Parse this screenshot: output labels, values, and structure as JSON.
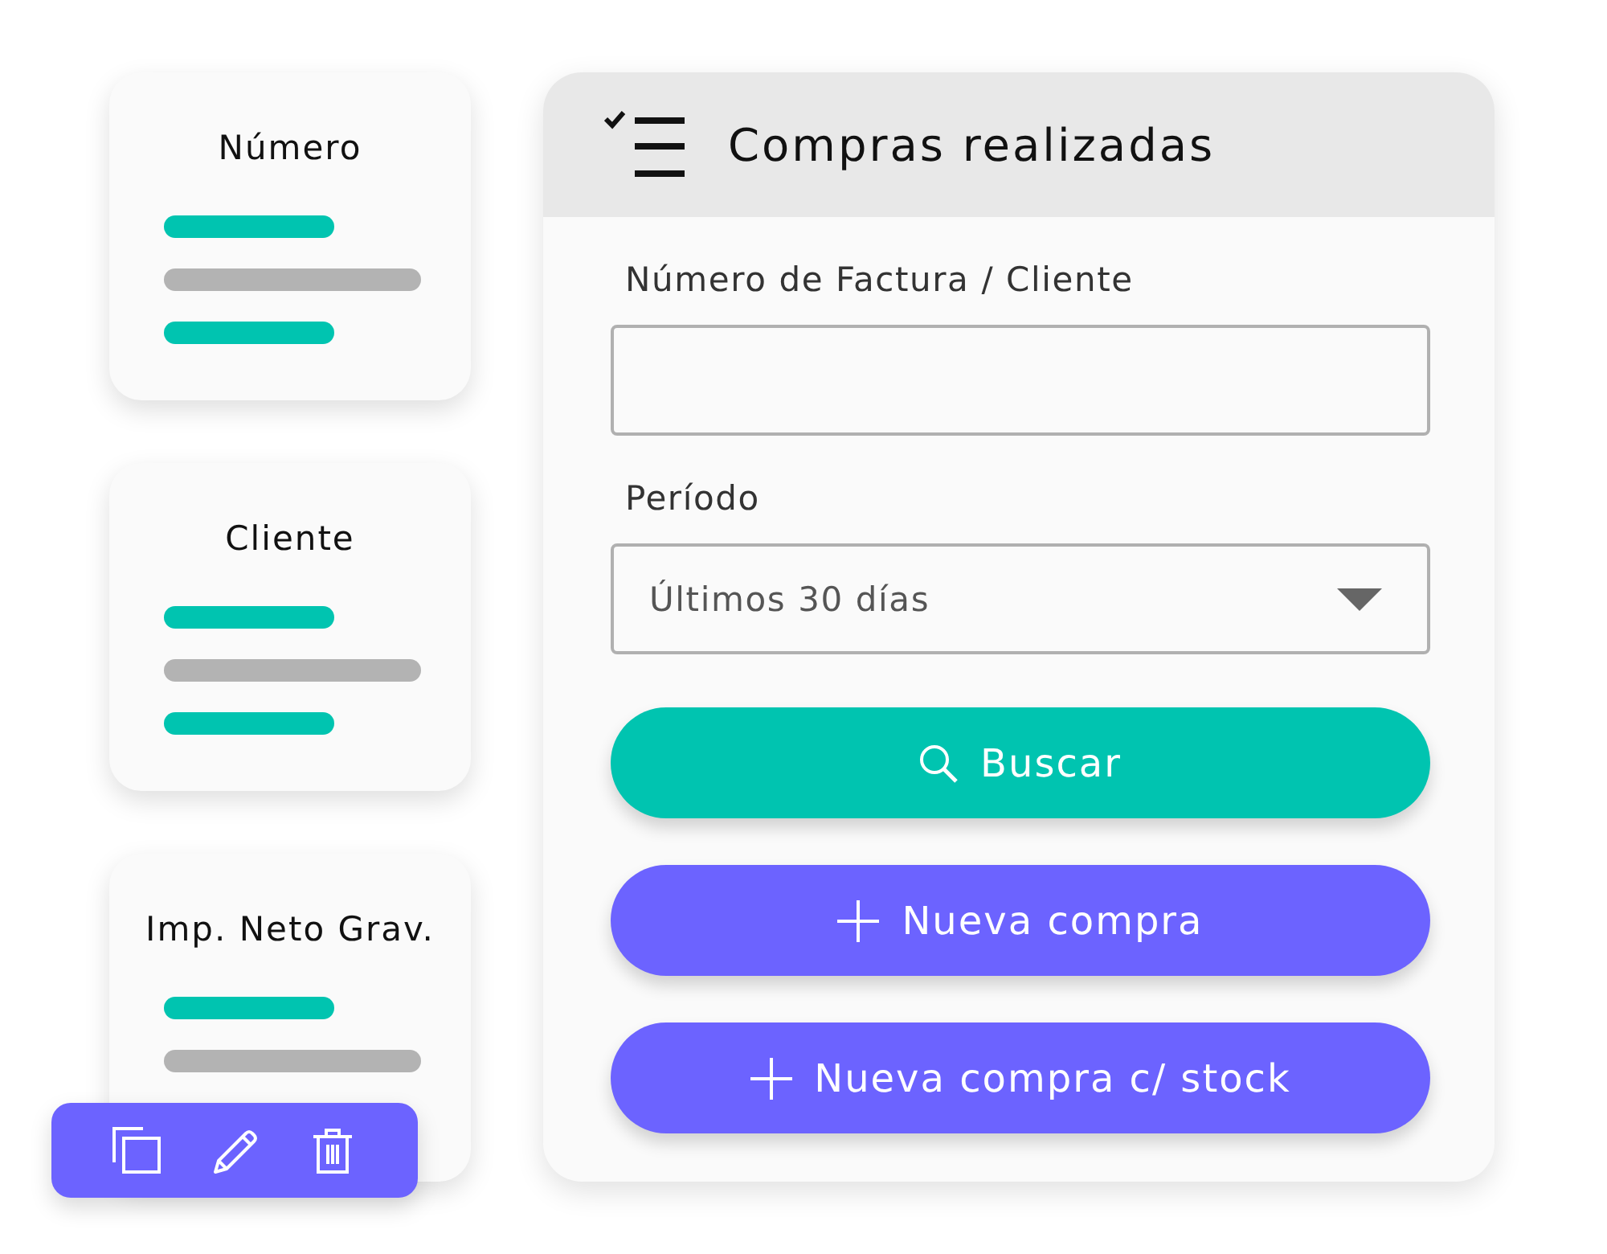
{
  "cards": [
    {
      "title": "Número",
      "lines": [
        {
          "kind": "accent"
        },
        {
          "kind": "plain"
        },
        {
          "kind": "accent"
        }
      ]
    },
    {
      "title": "Cliente",
      "lines": [
        {
          "kind": "accent"
        },
        {
          "kind": "plain"
        },
        {
          "kind": "accent"
        }
      ]
    },
    {
      "title": "Imp. Neto Grav.",
      "lines": [
        {
          "kind": "accent"
        },
        {
          "kind": "plain"
        }
      ]
    }
  ],
  "panel": {
    "title": "Compras realizadas",
    "fields": [
      {
        "kind": "text",
        "label": "Número de Factura / Cliente"
      },
      {
        "kind": "select",
        "label": "Período",
        "value": "Últimos 30 días"
      }
    ],
    "buttons": [
      {
        "kind": "search",
        "label": "Buscar"
      },
      {
        "kind": "add",
        "label": "Nueva compra"
      },
      {
        "kind": "add",
        "label": "Nueva compra c/ stock"
      }
    ]
  }
}
